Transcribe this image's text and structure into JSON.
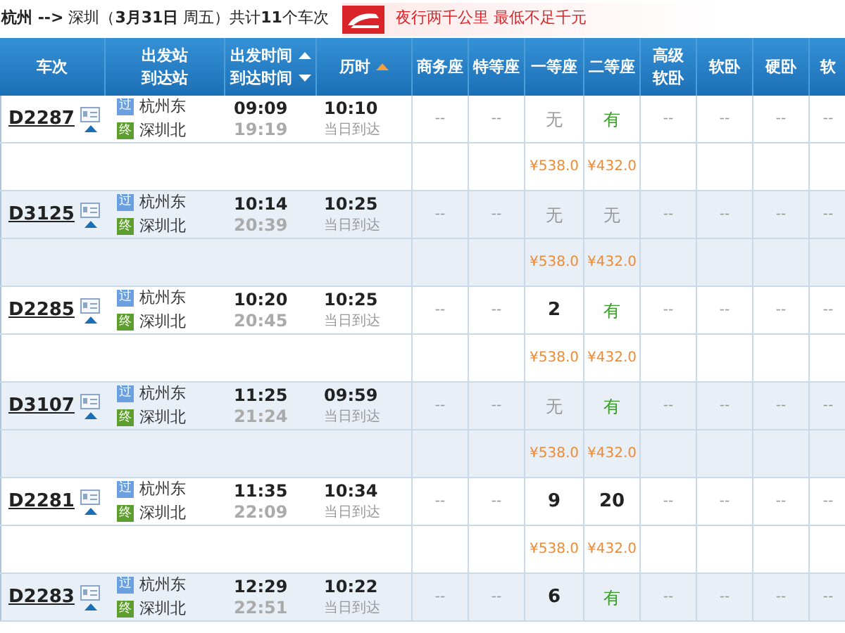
{
  "title": "**杭州 -->** 深圳（**3月31日** 周五）共计**11**个车次",
  "banner": {
    "text": "夜行两千公里 最低不足千元"
  },
  "columns": [
    {
      "label": "车次"
    },
    {
      "label": "出发站",
      "label2": "到达站"
    },
    {
      "label": "出发时间",
      "label2": "到达时间",
      "sort_up": true,
      "sort_down": true,
      "sorted": false
    },
    {
      "label": "历时",
      "sort_up": true,
      "sorted": true
    },
    {
      "label": "商务座"
    },
    {
      "label": "特等座"
    },
    {
      "label": "一等座"
    },
    {
      "label": "二等座"
    },
    {
      "label": "高级",
      "label2": "软卧"
    },
    {
      "label": "软卧"
    },
    {
      "label": "硬卧"
    },
    {
      "label": "软"
    }
  ],
  "trains": [
    {
      "number": "D2287",
      "from_badge": "过",
      "from": "杭州东",
      "to_badge": "终",
      "to": "深圳北",
      "depart": "09:09",
      "arrive": "19:19",
      "duration": "10:10",
      "arrival_day": "当日到达",
      "seats": [
        {
          "text": "--",
          "kind": "dash"
        },
        {
          "text": "--",
          "kind": "dash"
        },
        {
          "text": "无",
          "kind": "none"
        },
        {
          "text": "有",
          "kind": "yes"
        },
        {
          "text": "--",
          "kind": "dash"
        },
        {
          "text": "--",
          "kind": "dash"
        },
        {
          "text": "--",
          "kind": "dash"
        },
        {
          "text": "--",
          "kind": "dash"
        }
      ],
      "prices": [
        "¥538.0",
        "¥432.0"
      ]
    },
    {
      "number": "D3125",
      "from_badge": "过",
      "from": "杭州东",
      "to_badge": "终",
      "to": "深圳北",
      "depart": "10:14",
      "arrive": "20:39",
      "duration": "10:25",
      "arrival_day": "当日到达",
      "seats": [
        {
          "text": "--",
          "kind": "dash"
        },
        {
          "text": "--",
          "kind": "dash"
        },
        {
          "text": "无",
          "kind": "none"
        },
        {
          "text": "无",
          "kind": "none"
        },
        {
          "text": "--",
          "kind": "dash"
        },
        {
          "text": "--",
          "kind": "dash"
        },
        {
          "text": "--",
          "kind": "dash"
        },
        {
          "text": "--",
          "kind": "dash"
        }
      ],
      "prices": [
        "¥538.0",
        "¥432.0"
      ]
    },
    {
      "number": "D2285",
      "from_badge": "过",
      "from": "杭州东",
      "to_badge": "终",
      "to": "深圳北",
      "depart": "10:20",
      "arrive": "20:45",
      "duration": "10:25",
      "arrival_day": "当日到达",
      "seats": [
        {
          "text": "--",
          "kind": "dash"
        },
        {
          "text": "--",
          "kind": "dash"
        },
        {
          "text": "2",
          "kind": "count"
        },
        {
          "text": "有",
          "kind": "yes"
        },
        {
          "text": "--",
          "kind": "dash"
        },
        {
          "text": "--",
          "kind": "dash"
        },
        {
          "text": "--",
          "kind": "dash"
        },
        {
          "text": "--",
          "kind": "dash"
        }
      ],
      "prices": [
        "¥538.0",
        "¥432.0"
      ]
    },
    {
      "number": "D3107",
      "from_badge": "过",
      "from": "杭州东",
      "to_badge": "终",
      "to": "深圳北",
      "depart": "11:25",
      "arrive": "21:24",
      "duration": "09:59",
      "arrival_day": "当日到达",
      "seats": [
        {
          "text": "--",
          "kind": "dash"
        },
        {
          "text": "--",
          "kind": "dash"
        },
        {
          "text": "无",
          "kind": "none"
        },
        {
          "text": "有",
          "kind": "yes"
        },
        {
          "text": "--",
          "kind": "dash"
        },
        {
          "text": "--",
          "kind": "dash"
        },
        {
          "text": "--",
          "kind": "dash"
        },
        {
          "text": "--",
          "kind": "dash"
        }
      ],
      "prices": [
        "¥538.0",
        "¥432.0"
      ]
    },
    {
      "number": "D2281",
      "from_badge": "过",
      "from": "杭州东",
      "to_badge": "终",
      "to": "深圳北",
      "depart": "11:35",
      "arrive": "22:09",
      "duration": "10:34",
      "arrival_day": "当日到达",
      "seats": [
        {
          "text": "--",
          "kind": "dash"
        },
        {
          "text": "--",
          "kind": "dash"
        },
        {
          "text": "9",
          "kind": "count"
        },
        {
          "text": "20",
          "kind": "count"
        },
        {
          "text": "--",
          "kind": "dash"
        },
        {
          "text": "--",
          "kind": "dash"
        },
        {
          "text": "--",
          "kind": "dash"
        },
        {
          "text": "--",
          "kind": "dash"
        }
      ],
      "prices": [
        "¥538.0",
        "¥432.0"
      ]
    },
    {
      "number": "D2283",
      "from_badge": "过",
      "from": "杭州东",
      "to_badge": "终",
      "to": "深圳北",
      "depart": "12:29",
      "arrive": "22:51",
      "duration": "10:22",
      "arrival_day": "当日到达",
      "seats": [
        {
          "text": "--",
          "kind": "dash"
        },
        {
          "text": "--",
          "kind": "dash"
        },
        {
          "text": "6",
          "kind": "count"
        },
        {
          "text": "有",
          "kind": "yes"
        },
        {
          "text": "--",
          "kind": "dash"
        },
        {
          "text": "--",
          "kind": "dash"
        },
        {
          "text": "--",
          "kind": "dash"
        },
        {
          "text": "--",
          "kind": "dash"
        }
      ]
    }
  ]
}
